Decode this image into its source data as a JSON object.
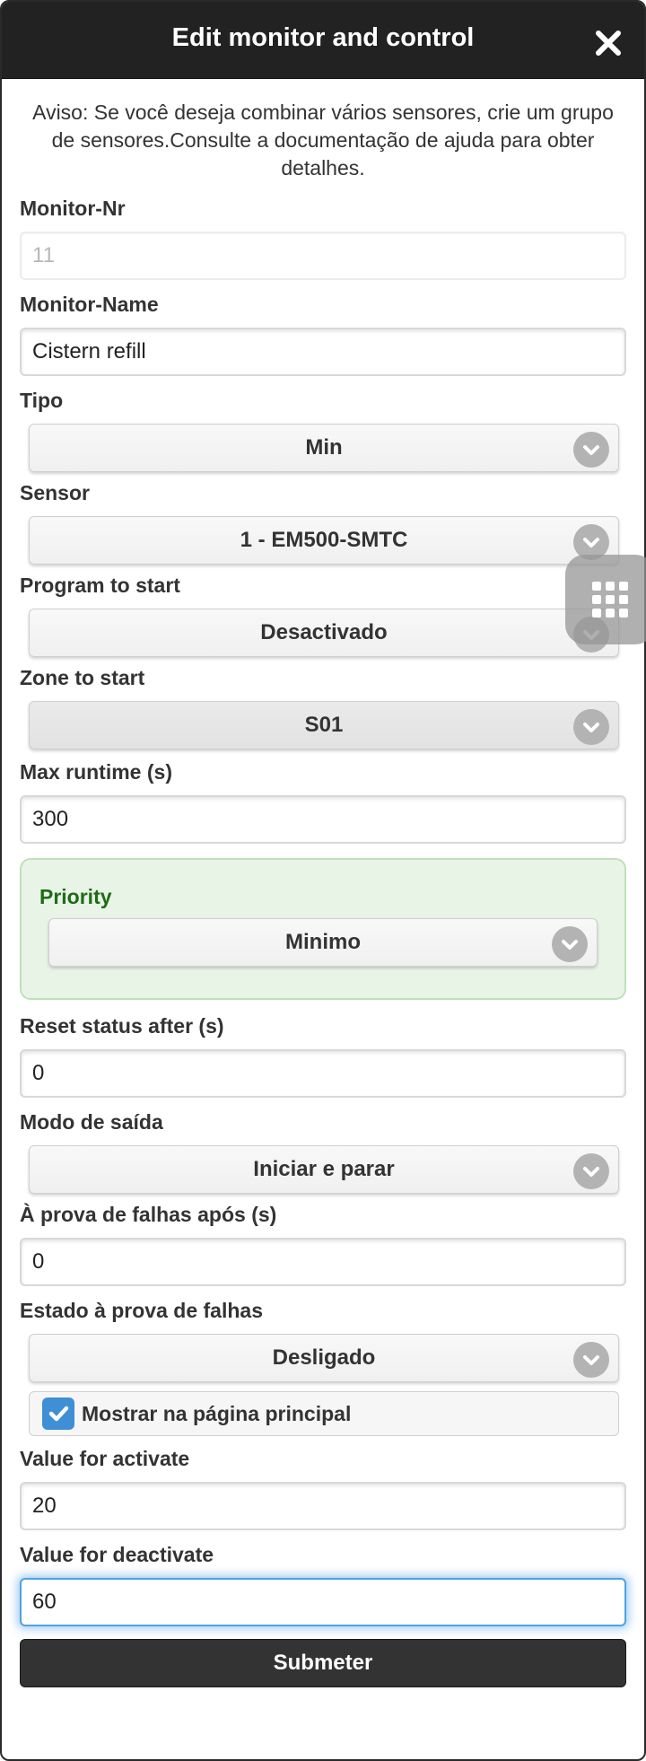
{
  "header": {
    "title": "Edit monitor and control"
  },
  "notice": "Aviso: Se você deseja combinar vários sensores, crie um grupo de sensores.Consulte a documentação de ajuda para obter detalhes.",
  "form": {
    "monitor_nr": {
      "label": "Monitor-Nr",
      "value": "11"
    },
    "monitor_name": {
      "label": "Monitor-Name",
      "value": "Cistern refill"
    },
    "tipo": {
      "label": "Tipo",
      "value": "Min"
    },
    "sensor": {
      "label": "Sensor",
      "value": "1 - EM500-SMTC"
    },
    "program": {
      "label": "Program to start",
      "value": "Desactivado"
    },
    "zone": {
      "label": "Zone to start",
      "value": "S01"
    },
    "max_runtime": {
      "label": "Max runtime (s)",
      "value": "300"
    },
    "priority": {
      "label": "Priority",
      "value": "Minimo"
    },
    "reset_status": {
      "label": "Reset status after (s)",
      "value": "0"
    },
    "output_mode": {
      "label": "Modo de saída",
      "value": "Iniciar e parar"
    },
    "failsafe_after": {
      "label": "À prova de falhas após (s)",
      "value": "0"
    },
    "failsafe_state": {
      "label": "Estado à prova de falhas",
      "value": "Desligado"
    },
    "show_main": {
      "label": "Mostrar na página principal",
      "checked": true
    },
    "value_activate": {
      "label": "Value for activate",
      "value": "20"
    },
    "value_deactivate": {
      "label": "Value for deactivate",
      "value": "60"
    },
    "submit_label": "Submeter"
  },
  "icons": {
    "close": "close-icon",
    "chevron": "chevron-down-icon",
    "check": "check-icon",
    "grid": "grid-icon"
  },
  "colors": {
    "header_bg": "#222222",
    "accent_blue": "#3f8fd4",
    "priority_bg": "#e8f4e6",
    "priority_text": "#1f6b18",
    "submit_bg": "#333333"
  }
}
